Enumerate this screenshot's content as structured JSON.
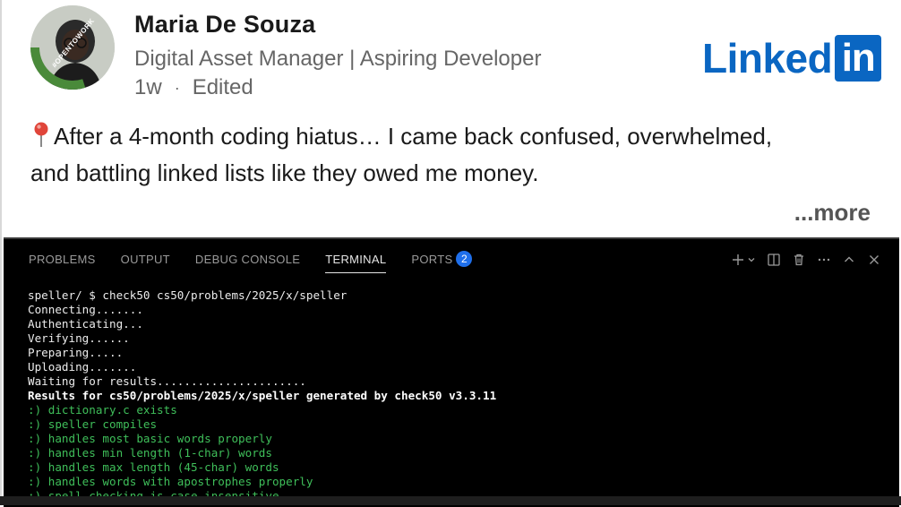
{
  "post": {
    "author_name": "Maria De Souza",
    "author_headline": "Digital Asset Manager | Aspiring Developer",
    "time_ago": "1w",
    "meta_separator": "·",
    "edited_label": "Edited",
    "avatar_frame_text": "#OPENTOWORK",
    "brand": {
      "word": "Linked",
      "box": "in",
      "color": "#0a66c2"
    },
    "text_line_1": "After a 4-month coding hiatus… I came back confused, overwhelmed,",
    "text_line_2": "and battling linked lists like they owed me money.",
    "see_more_label": "...more",
    "pin_icon": "round-pushpin-icon"
  },
  "panel": {
    "tabs": [
      {
        "label": "PROBLEMS"
      },
      {
        "label": "OUTPUT"
      },
      {
        "label": "DEBUG CONSOLE"
      },
      {
        "label": "TERMINAL",
        "active": true
      },
      {
        "label": "PORTS",
        "badge": "2"
      }
    ],
    "actions": [
      "plus-icon",
      "chevron-down-icon",
      "split-icon",
      "trash-icon",
      "more-icon",
      "chevron-up-icon",
      "close-icon"
    ]
  },
  "terminal": {
    "lines": [
      {
        "text": "speller/ $ check50 cs50/problems/2025/x/speller",
        "style": "white"
      },
      {
        "text": "Connecting.......",
        "style": "white"
      },
      {
        "text": "Authenticating...",
        "style": "white"
      },
      {
        "text": "Verifying......",
        "style": "white"
      },
      {
        "text": "Preparing.....",
        "style": "white"
      },
      {
        "text": "Uploading.......",
        "style": "white"
      },
      {
        "text": "Waiting for results......................",
        "style": "white"
      },
      {
        "text": "Results for cs50/problems/2025/x/speller generated by check50 v3.3.11",
        "style": "bold"
      },
      {
        "text": ":) dictionary.c exists",
        "style": "green"
      },
      {
        "text": ":) speller compiles",
        "style": "green"
      },
      {
        "text": ":) handles most basic words properly",
        "style": "green"
      },
      {
        "text": ":) handles min length (1-char) words",
        "style": "green"
      },
      {
        "text": ":) handles max length (45-char) words",
        "style": "green"
      },
      {
        "text": ":) handles words with apostrophes properly",
        "style": "green"
      },
      {
        "text": ":) spell-checking is case-insensitive",
        "style": "green"
      }
    ]
  }
}
